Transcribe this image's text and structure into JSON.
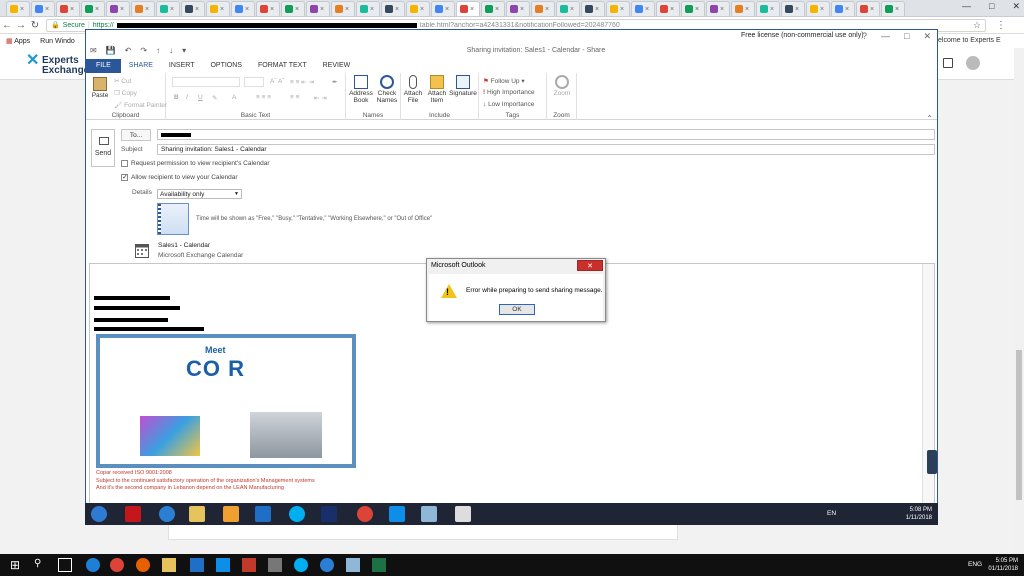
{
  "browser": {
    "tabs_count": 36,
    "address": {
      "secure_label": "Secure",
      "url_prefix": "https://",
      "url_visible": "table.html?anchor=a42431331&notificationFollowed=202487760"
    },
    "bookmarks": {
      "apps": "Apps",
      "run_window": "Run Windo"
    }
  },
  "website": {
    "logo_top": "Experts",
    "logo_bottom": "Exchange",
    "welcome": "elcome to Experts E"
  },
  "outlook": {
    "window_title": "Sharing invitation: Sales1 - Calendar - Share",
    "free_license": "Free license (non-commercial use only)",
    "ribbon_tabs": [
      "FILE",
      "SHARE",
      "INSERT",
      "OPTIONS",
      "FORMAT TEXT",
      "REVIEW"
    ],
    "ribbon": {
      "paste": "Paste",
      "cut": "Cut",
      "copy": "Copy",
      "format_painter": "Format Painter",
      "group_clipboard": "Clipboard",
      "group_basic_text": "Basic Text",
      "address_book": "Address Book",
      "check_names": "Check Names",
      "group_names": "Names",
      "attach_file": "Attach File",
      "attach_item": "Attach Item",
      "signature": "Signature",
      "group_include": "Include",
      "follow_up": "Follow Up",
      "high_importance": "High Importance",
      "low_importance": "Low Importance",
      "group_tags": "Tags",
      "zoom": "Zoom",
      "group_zoom": "Zoom"
    },
    "compose": {
      "send": "Send",
      "to_button": "To...",
      "subject_label": "Subject",
      "subject_value": "Sharing invitation: Sales1 - Calendar",
      "request_permission": "Request permission to view recipient's Calendar",
      "allow_view": "Allow recipient to view your Calendar",
      "details_label": "Details",
      "details_value": "Availability only",
      "availability_hint": "Time will be shown as \"Free,\" \"Busy,\" \"Tentative,\" \"Working Elsewhere,\" or \"Out of Office\"",
      "calendar_name": "Sales1 - Calendar",
      "calendar_source": "Microsoft Exchange Calendar"
    },
    "body": {
      "banner_meet": "Meet",
      "banner_brand": "CO   R",
      "signature_lines": [
        "Copar received ISO 9001:2008",
        "Subject to the continued satisfactory operation of the organization's Management systems",
        "And it's the second company in Lebanon depend on the LEAN Manufacturing"
      ]
    }
  },
  "dialog": {
    "title": "Microsoft Outlook",
    "message": "Error while preparing to send sharing message.",
    "ok": "OK"
  },
  "inner_taskbar": {
    "lang": "EN",
    "time": "5:08 PM",
    "date": "1/11/2018"
  },
  "outer_taskbar": {
    "lang": "ENG",
    "time": "5:05 PM",
    "date": "01/11/2018"
  }
}
